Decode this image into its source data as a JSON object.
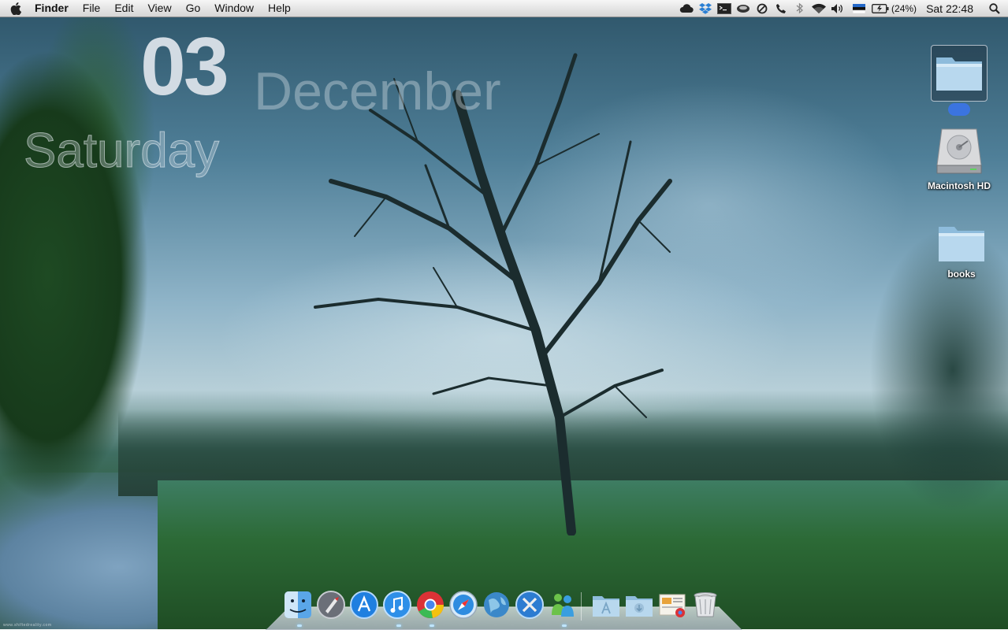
{
  "menubar": {
    "app_name": "Finder",
    "items": [
      "File",
      "Edit",
      "View",
      "Go",
      "Window",
      "Help"
    ],
    "status_icons": [
      "icloud-icon",
      "dropbox-icon",
      "terminal-icon",
      "coffee-icon",
      "sync-icon",
      "phone-icon",
      "bluetooth-icon",
      "wifi-icon",
      "volume-icon",
      "flag-icon",
      "battery-icon"
    ],
    "battery_percent": "(24%)",
    "clock": "Sat 22:48"
  },
  "date_widget": {
    "day": "03",
    "month": "December",
    "weekday": "Saturday"
  },
  "desktop": {
    "icons": [
      {
        "label": "",
        "icon": "folder-icon",
        "selected": true
      },
      {
        "label": "Macintosh HD",
        "icon": "hard-drive-icon"
      },
      {
        "label": "books",
        "icon": "folder-icon"
      }
    ]
  },
  "dock": {
    "apps": [
      "finder-icon",
      "launchpad-icon",
      "app-store-icon",
      "itunes-icon",
      "chrome-icon",
      "safari-icon",
      "globe-icon",
      "system-tools-icon",
      "messenger-icon"
    ],
    "stacks": [
      "applications-folder-icon",
      "downloads-folder-icon",
      "documents-stack-icon",
      "trash-icon"
    ]
  },
  "watermark": "www.shiftedreality.com",
  "colors": {
    "menubar_bg": "#e6e6e6",
    "selection_blue": "#3b74e0",
    "folder_blue": "#a9cde6"
  }
}
